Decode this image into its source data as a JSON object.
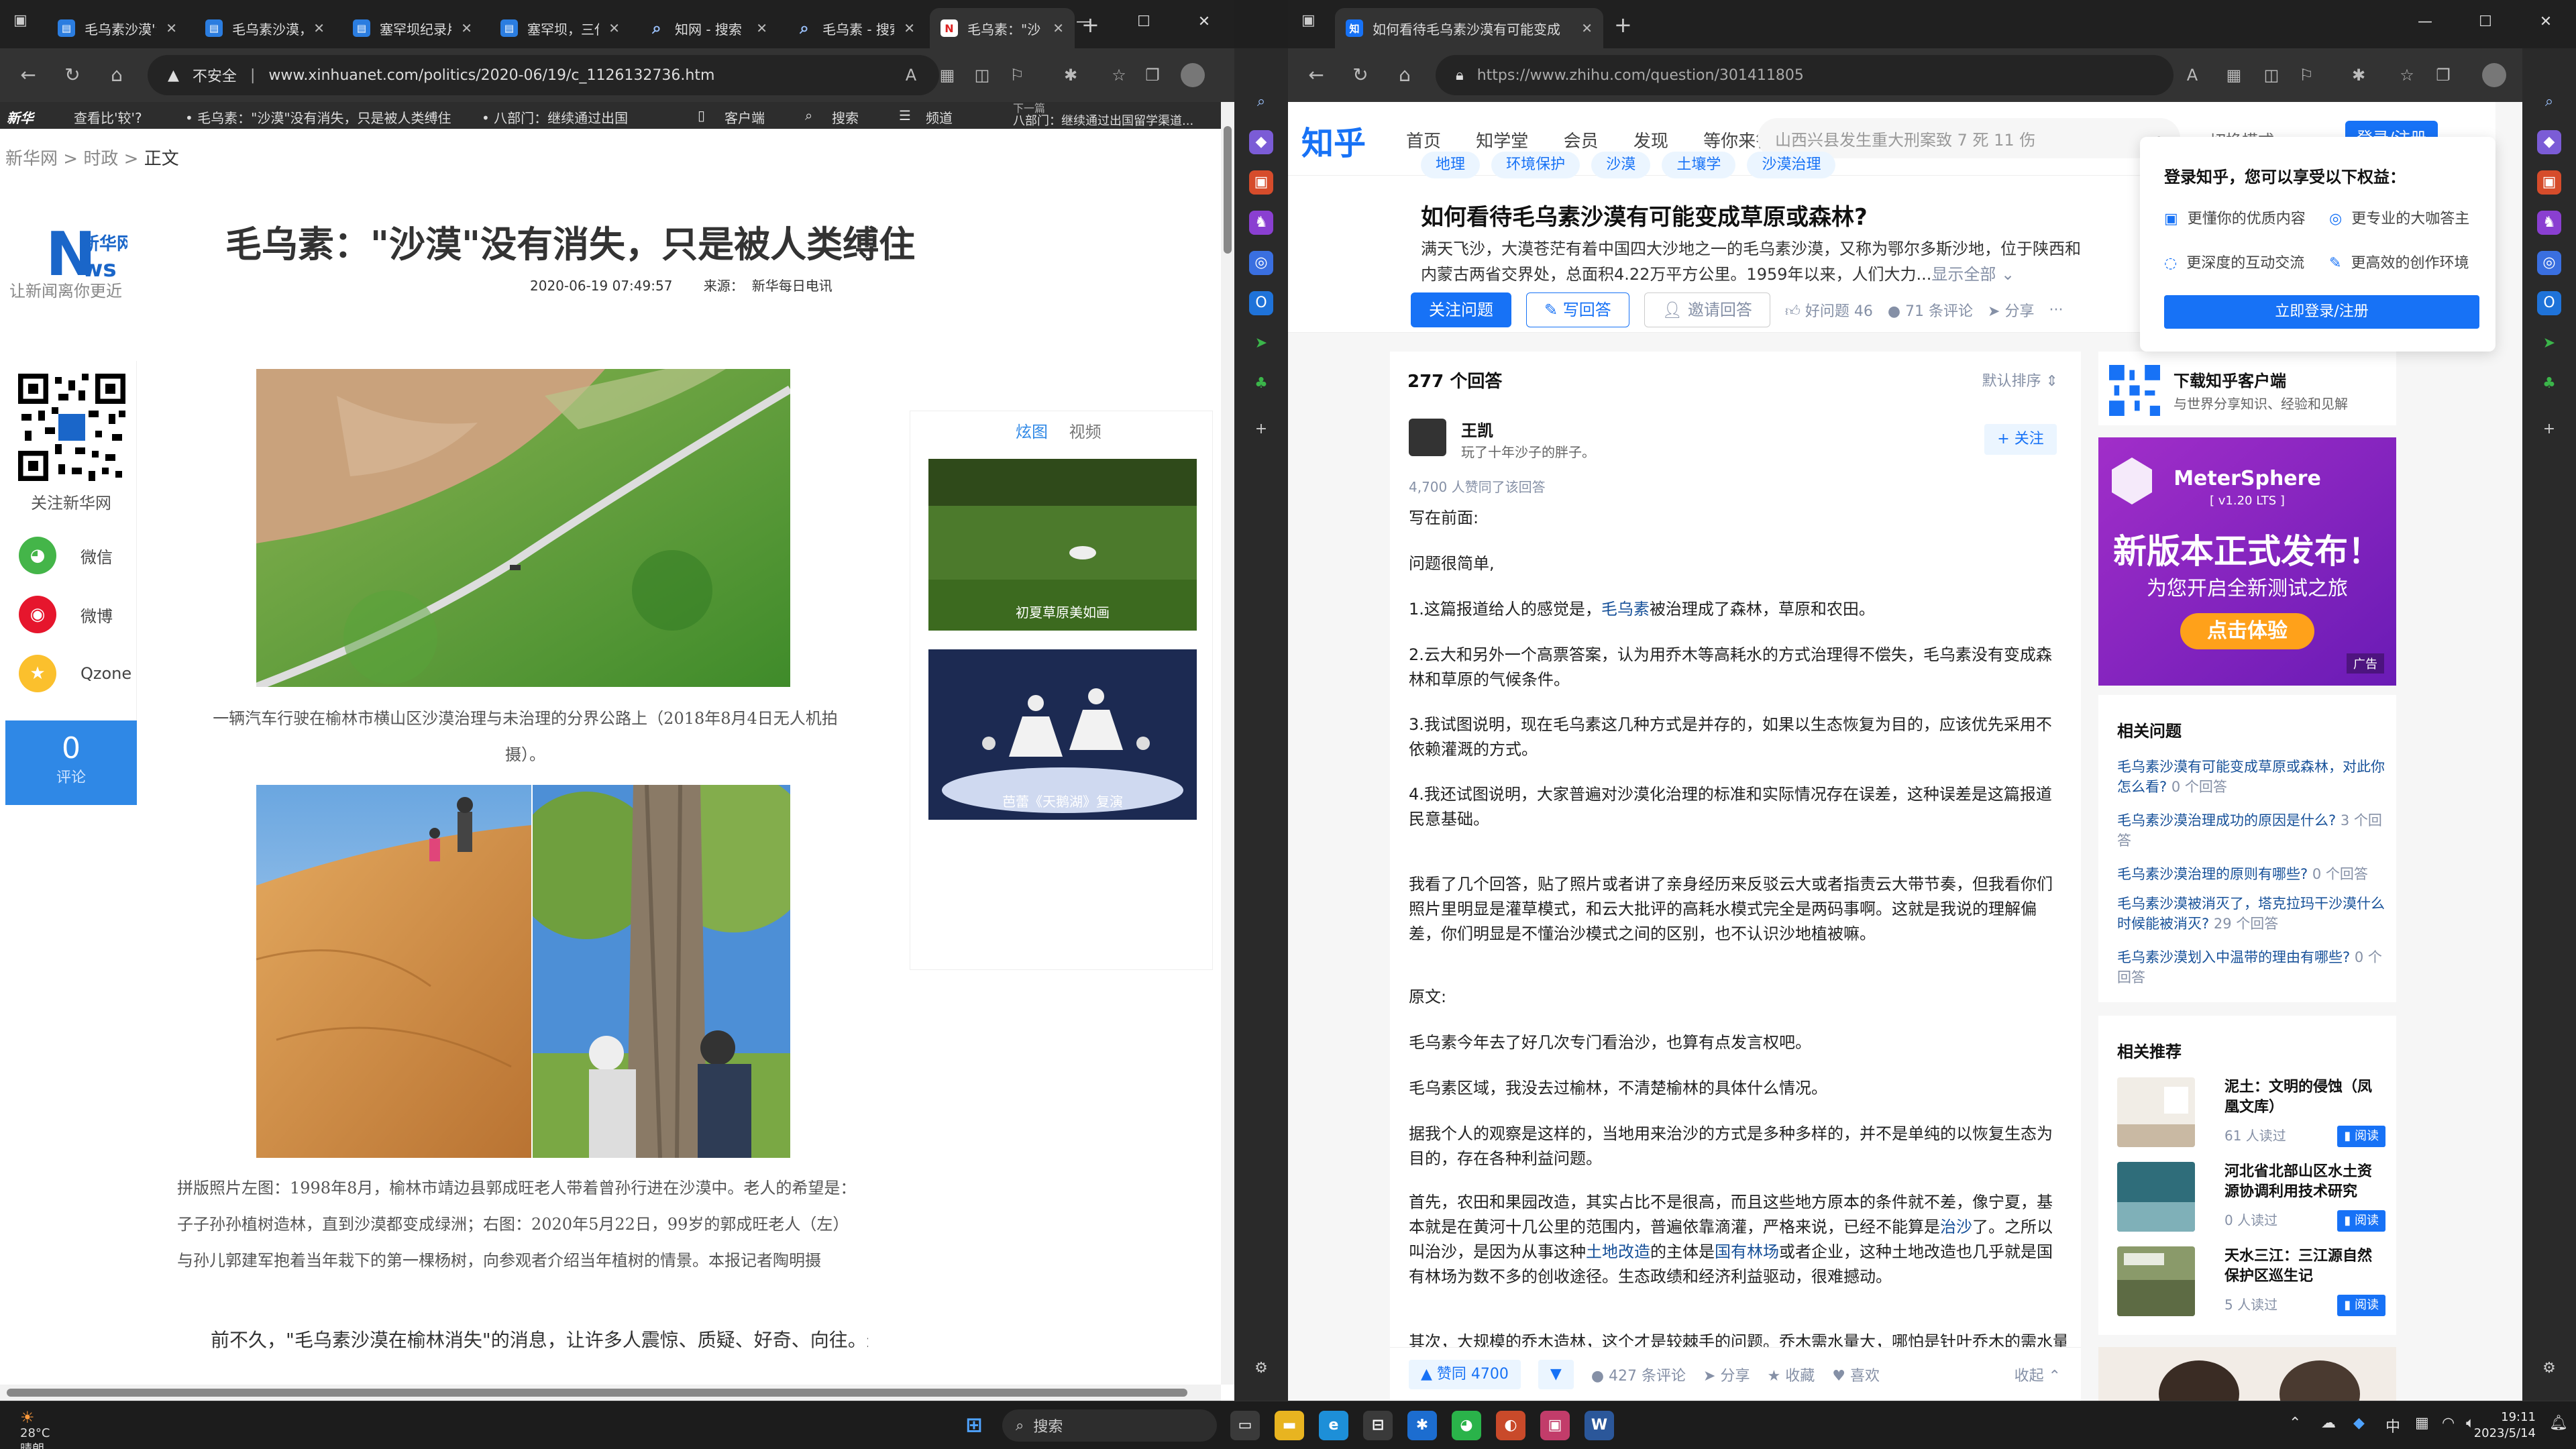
{
  "left_window": {
    "tabs": [
      {
        "label": "毛乌素沙漠'治'"
      },
      {
        "label": "毛乌素沙漠，ll"
      },
      {
        "label": "塞罕坝纪录片"
      },
      {
        "label": "塞罕坝，三代"
      },
      {
        "label": "知网 - 搜索"
      },
      {
        "label": "毛乌素 - 搜索"
      },
      {
        "label": "毛乌素：\"沙"
      }
    ],
    "security": "不安全",
    "url": "www.xinhuanet.com/politics/2020-06/19/c_1126132736.htm",
    "top_bar": {
      "brand": "新华",
      "item1": "查看比'较'?",
      "item2": "• 毛乌素：\"沙漠\"没有消失，只是被人类缚住",
      "item3": "• 八部门：继续通过出国",
      "client": "客户端",
      "search": "搜索",
      "channel": "频道",
      "next_label": "下一篇",
      "next_title": "八部门：继续通过出国留学渠道..."
    },
    "breadcrumb": {
      "site": "新华网",
      "sep1": ">",
      "section": "时政",
      "sep2": ">",
      "current": "正文"
    },
    "logo_slogan": "让新闻离你更近",
    "headline": "毛乌素：\"沙漠\"没有消失，只是被人类缚住",
    "date": "2020-06-19 07:49:57",
    "source_label": "来源：",
    "source": "新华每日电讯",
    "follow": "关注新华网",
    "share": [
      {
        "label": "微信",
        "icon": "wechat-icon",
        "color": "#44b549"
      },
      {
        "label": "微博",
        "icon": "weibo-icon",
        "color": "#e6162d"
      },
      {
        "label": "Qzone",
        "icon": "qzone-icon",
        "color": "#fbc02d"
      }
    ],
    "comment_count": "0",
    "comment_label": "评论",
    "caption1": "一辆汽车行驶在榆林市横山区沙漠治理与未治理的分界公路上（2018年8月4日无人机拍摄）。",
    "caption2": "拼版照片左图：1998年8月，榆林市靖边县郭成旺老人带着曾孙行进在沙漠中。老人的希望是：子子孙孙植树造林，直到沙漠都变成绿洲；右图：2020年5月22日，99岁的郭成旺老人（左）与孙儿郭建军抱着当年栽下的第一棵杨树，向参观者介绍当年植树的情景。本报记者陶明摄",
    "body_start": "前不久，\"毛乌素沙漠在榆林消失\"的消息，让许多人震惊、质疑、好奇、向往。最",
    "side_tabs": {
      "active": "炫图",
      "other": "视频"
    },
    "thumbs": [
      {
        "caption": "初夏草原美如画"
      },
      {
        "caption": "芭蕾《天鹅湖》复演"
      }
    ]
  },
  "right_window": {
    "tab": "如何看待毛乌素沙漠有可能变成",
    "url": "https://www.zhihu.com/question/301411805",
    "logo": "知乎",
    "nav": [
      "首页",
      "知学堂",
      "会员",
      "发现",
      "等你来答"
    ],
    "search_placeholder": "山西兴县发生重大刑案致 7 死 11 伤",
    "mode": "切换模式",
    "login": "登录/注册",
    "tags": [
      "地理",
      "环境保护",
      "沙漠",
      "土壤学",
      "沙漠治理"
    ],
    "question_title": "如何看待毛乌素沙漠有可能变成草原或森林?",
    "question_desc": "满天飞沙，大漠苍茫有着中国四大沙地之一的毛乌素沙漠，又称为鄂尔多斯沙地，位于陕西和内蒙古两省交界处，总面积4.22万平方公里。1959年以来，人们大力...",
    "show_all": "显示全部 ⌄",
    "actions": {
      "follow_q": "关注问题",
      "write": "写回答",
      "invite": "邀请回答",
      "good": "好问题 46",
      "comments": "71 条评论",
      "share": "分享",
      "more": "···"
    },
    "popup": {
      "title": "登录知乎，您可以享受以下权益：",
      "items": [
        "更懂你的优质内容",
        "更专业的大咖答主",
        "更深度的互动交流",
        "更高效的创作环境"
      ],
      "button": "立即登录/注册"
    },
    "answers": {
      "count": "277 个回答",
      "sort": "默认排序 ⇕",
      "author": "王凯",
      "bio": "玩了十年沙子的胖子。",
      "follow": "+ 关注",
      "votes": "4,700 人赞同了该回答",
      "p1": "写在前面:",
      "p2": "问题很简单,",
      "p3a": "1.这篇报道给人的感觉是，",
      "p3link": "毛乌素",
      "p3b": "被治理成了森林，草原和农田。",
      "p4": "2.云大和另外一个高票答案，认为用乔木等高耗水的方式治理得不偿失，毛乌素没有变成森林和草原的气候条件。",
      "p5": "3.我试图说明，现在毛乌素这几种方式是并存的，如果以生态恢复为目的，应该优先采用不依赖灌溉的方式。",
      "p6": "4.我还试图说明，大家普遍对沙漠化治理的标准和实际情况存在误差，这种误差是这篇报道民意基础。",
      "p7": "我看了几个回答，贴了照片或者讲了亲身经历来反驳云大或者指责云大带节奏，但我看你们照片里明显是灌草模式，和云大批评的高耗水模式完全是两码事啊。这就是我说的理解偏差，你们明显是不懂治沙模式之间的区别，也不认识沙地植被嘛。",
      "p8": "原文:",
      "p9": "毛乌素今年去了好几次专门看治沙，也算有点发言权吧。",
      "p10": "毛乌素区域，我没去过榆林，不清楚榆林的具体什么情况。",
      "p11": "据我个人的观察是这样的，当地用来治沙的方式是多种多样的，并不是单纯的以恢复生态为目的，存在各种利益问题。",
      "p12a": "首先，农田和果园改造，其实占比不是很高，而且这些地方原本的条件就不差，像宁夏，基本就是在黄河十几公里的范围内，普遍依靠滴灌，严格来说，已经不能算是",
      "p12link1": "治沙",
      "p12b": "了。之所以叫治沙，是因为从事这种",
      "p12link2": "土地改造",
      "p12c": "的主体是",
      "p12link3": "国有林场",
      "p12d": "或者企业，这种土地改造也几乎就是国有林场为数不多的创收途径。生态政绩和经济利益驱动，很难撼动。",
      "p13": "其次，大规模的乔木造林，这个才是较棘手的问题。乔木需水量大，哪怕是针叶乔木的需水量也超",
      "vote": "▲ 赞同 4700",
      "down": "▼",
      "comments": "427 条评论",
      "share": "分享",
      "favorite": "收藏",
      "like": "喜欢",
      "fold": "收起 ⌃"
    },
    "download": {
      "title": "下载知乎客户端",
      "sub": "与世界分享知识、经验和见解"
    },
    "ad": {
      "brand": "MeterSphere",
      "version": "[ v1.20 LTS ]",
      "headline": "新版本正式发布！",
      "sub": "为您开启全新测试之旅",
      "cta": "点击体验",
      "tag": "广告"
    },
    "related_title": "相关问题",
    "related": [
      {
        "q": "毛乌素沙漠有可能变成草原或森林，对此你怎么看?",
        "c": "0 个回答"
      },
      {
        "q": "毛乌素沙漠治理成功的原因是什么?",
        "c": "3 个回答"
      },
      {
        "q": "毛乌素沙漠治理的原则有哪些?",
        "c": "0 个回答"
      },
      {
        "q": "毛乌素沙漠被消灭了，塔克拉玛干沙漠什么时候能被消灭?",
        "c": "29 个回答"
      },
      {
        "q": "毛乌素沙漠划入中温带的理由有哪些?",
        "c": "0 个回答"
      }
    ],
    "recommend_title": "相关推荐",
    "books": [
      {
        "title": "泥土：文明的侵蚀（凤凰文库）",
        "readers": "61 人读过",
        "read": "▮ 阅读"
      },
      {
        "title": "河北省北部山区水土资源协调利用技术研究",
        "readers": "0 人读过",
        "read": "▮ 阅读"
      },
      {
        "title": "天水三江：三江源自然保护区巡生记",
        "readers": "5 人读过",
        "read": "▮ 阅读"
      }
    ]
  },
  "taskbar": {
    "temp": "28°C",
    "weather": "晴朗",
    "search": "搜索",
    "time": "19:11",
    "date": "2023/5/14",
    "ime": "中"
  }
}
